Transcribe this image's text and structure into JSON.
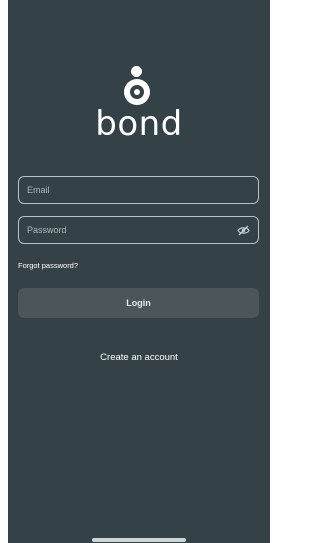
{
  "app": {
    "logo_text": "bond"
  },
  "form": {
    "email_placeholder": "Email",
    "password_placeholder": "Password",
    "toggle_visibility_icon": "eye-off-icon",
    "forgot_password": "Forgot password?",
    "login_label": "Login",
    "create_account": "Create an account"
  },
  "colors": {
    "background": "#344146",
    "button": "#4b565a",
    "field_border": "#b8c2c6"
  }
}
